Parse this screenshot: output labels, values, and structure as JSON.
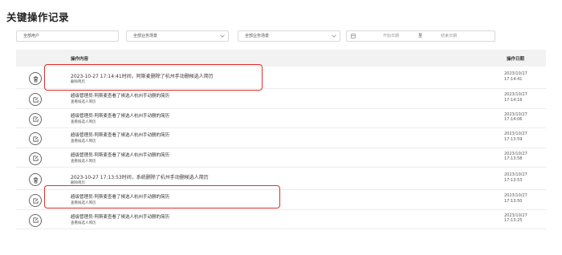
{
  "page": {
    "title": "关键操作记录"
  },
  "filters": {
    "user": "全部用户",
    "scene1": "全部业务场景",
    "scene2": "全部业务场景",
    "date_start": "开始日期",
    "date_sep": "至",
    "date_end": "结束日期"
  },
  "table": {
    "headers": {
      "content": "操作内容",
      "date": "操作日期"
    },
    "rows": [
      {
        "icon": "trash-icon",
        "title": "2023-10-27 17:14:41时间，阿斯麦删除了杭州手动删候选人简历",
        "sub": "删除简历",
        "date": "2023/10/27",
        "time": "17:14:41"
      },
      {
        "icon": "edit-icon",
        "title": "超级管理员-阿斯麦查看了候选人杭州手动删的简历",
        "sub": "查看候选人简历",
        "date": "2023/10/27",
        "time": "17:14:16"
      },
      {
        "icon": "edit-icon",
        "title": "超级管理员-阿斯麦查看了候选人杭州手动删的简历",
        "sub": "查看候选人简历",
        "date": "2023/10/27",
        "time": "17:14:06"
      },
      {
        "icon": "edit-icon",
        "title": "超级管理员-阿斯麦查看了候选人杭州手动删的简历",
        "sub": "查看候选人简历",
        "date": "2023/10/27",
        "time": "17:13:59"
      },
      {
        "icon": "edit-icon",
        "title": "超级管理员-阿斯麦查看了候选人杭州手动删的简历",
        "sub": "查看候选人简历",
        "date": "2023/10/27",
        "time": "17:13:58"
      },
      {
        "icon": "trash-icon",
        "title": "2023-10-27 17:13:53时间，系统删除了杭州手动删候选人简历",
        "sub": "删除简历",
        "date": "2023/10/27",
        "time": "17:13:53"
      },
      {
        "icon": "edit-icon",
        "title": "超级管理员-阿斯麦查看了候选人杭州手动删的简历",
        "sub": "查看候选人简历",
        "date": "2023/10/27",
        "time": "17:13:50"
      },
      {
        "icon": "edit-icon",
        "title": "超级管理员-阿斯麦查看了候选人杭州手动删的简历",
        "sub": "查看候选人简历",
        "date": "2023/10/27",
        "time": "17:13:25"
      }
    ]
  },
  "colors": {
    "highlight": "#e03030",
    "header_bg": "#f2f2f2"
  }
}
